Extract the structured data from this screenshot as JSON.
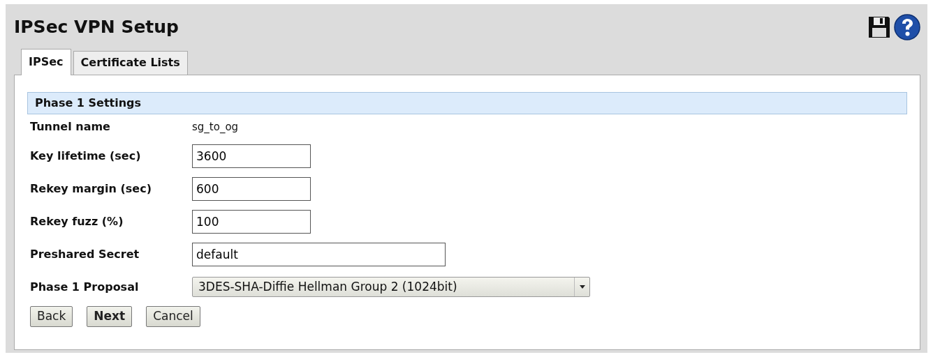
{
  "page": {
    "title": "IPSec VPN Setup"
  },
  "tabs": [
    {
      "label": "IPSec",
      "selected": true
    },
    {
      "label": "Certificate Lists",
      "selected": false
    }
  ],
  "section": {
    "title": "Phase 1 Settings"
  },
  "fields": [
    {
      "kind": "text",
      "label": "Tunnel name",
      "value": "sg_to_og"
    },
    {
      "kind": "input",
      "label": "Key lifetime (sec)",
      "value": "3600"
    },
    {
      "kind": "input",
      "label": "Rekey margin (sec)",
      "value": "600"
    },
    {
      "kind": "input",
      "label": "Rekey fuzz (%)",
      "value": "100"
    },
    {
      "kind": "wide-input",
      "label": "Preshared Secret",
      "value": "default"
    },
    {
      "kind": "select",
      "label": "Phase 1 Proposal",
      "value": "3DES-SHA-Diffie Hellman Group 2 (1024bit)"
    }
  ],
  "buttons": [
    {
      "label": "Back",
      "default": false
    },
    {
      "label": "Next",
      "default": true
    },
    {
      "label": "Cancel",
      "default": false
    }
  ]
}
